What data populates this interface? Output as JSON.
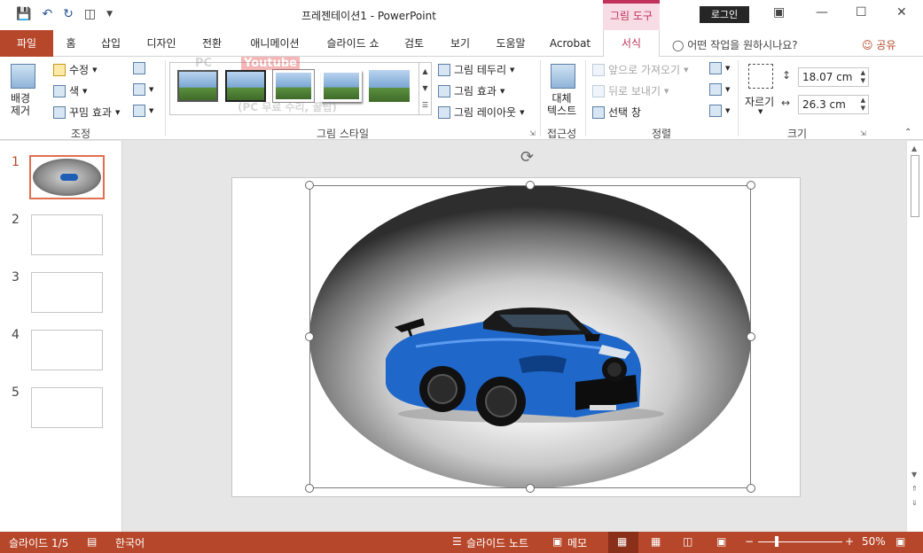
{
  "window": {
    "doc_title": "프레젠테이션1  -  PowerPoint",
    "context_tab_title": "그림 도구",
    "login_label": "로그인"
  },
  "qat": {
    "save_icon": "floppy-icon",
    "undo_icon": "undo-icon",
    "redo_icon": "redo-icon",
    "start_icon": "present-icon",
    "customize_icon": "customize-arrow-icon"
  },
  "tabs": [
    "파일",
    "홈",
    "삽입",
    "디자인",
    "전환",
    "애니메이션",
    "슬라이드 쇼",
    "검토",
    "보기",
    "도움말",
    "Acrobat",
    "서식"
  ],
  "tell_me": "어떤 작업을 원하시나요?",
  "share_label": "공유",
  "ribbon": {
    "adjust": {
      "remove_bg": "배경\n제거",
      "corrections": "수정",
      "color": "색",
      "artistic": "꾸밈 효과",
      "group": "조정"
    },
    "styles": {
      "border": "그림 테두리",
      "effects": "그림 효과",
      "layout": "그림 레이아웃",
      "group": "그림 스타일"
    },
    "accessibility": {
      "alt_text": "대체\n텍스트",
      "group": "접근성"
    },
    "arrange": {
      "bring_forward": "앞으로 가져오기",
      "send_backward": "뒤로 보내기",
      "selection_pane": "선택 창",
      "group": "정렬"
    },
    "size": {
      "crop": "자르기",
      "height": "18.07 cm",
      "width": "26.3 cm",
      "group": "크기"
    }
  },
  "watermark": {
    "line1": "PC",
    "line2": "Youtube",
    "line3": "(PC 무료 수리, 꿀팁)"
  },
  "slides": [
    "1",
    "2",
    "3",
    "4",
    "5"
  ],
  "status": {
    "slide_pos": "슬라이드 1/5",
    "language": "한국어",
    "notes": "슬라이드 노트",
    "comments": "메모",
    "zoom": "50%"
  }
}
